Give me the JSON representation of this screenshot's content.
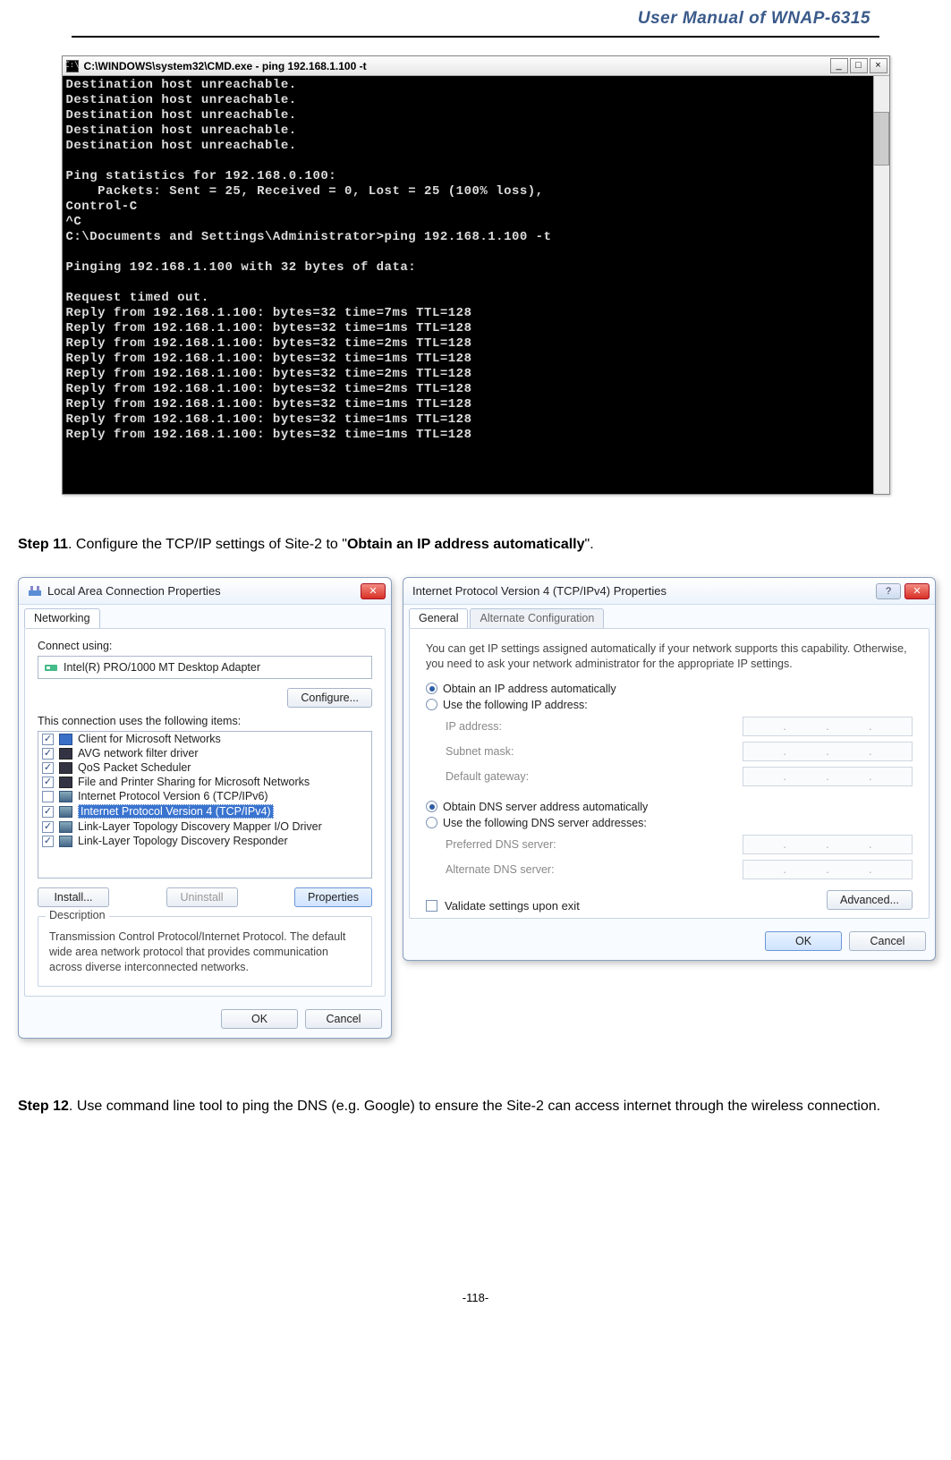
{
  "header": {
    "title": "User Manual of WNAP-6315"
  },
  "footer": {
    "page": "-118-"
  },
  "cmd": {
    "title": "C:\\WINDOWS\\system32\\CMD.exe - ping 192.168.1.100 -t",
    "lines": [
      "Destination host unreachable.",
      "Destination host unreachable.",
      "Destination host unreachable.",
      "Destination host unreachable.",
      "Destination host unreachable.",
      "",
      "Ping statistics for 192.168.0.100:",
      "    Packets: Sent = 25, Received = 0, Lost = 25 (100% loss),",
      "Control-C",
      "^C",
      "C:\\Documents and Settings\\Administrator>ping 192.168.1.100 -t",
      "",
      "Pinging 192.168.1.100 with 32 bytes of data:",
      "",
      "Request timed out.",
      "Reply from 192.168.1.100: bytes=32 time=7ms TTL=128",
      "Reply from 192.168.1.100: bytes=32 time=1ms TTL=128",
      "Reply from 192.168.1.100: bytes=32 time=2ms TTL=128",
      "Reply from 192.168.1.100: bytes=32 time=1ms TTL=128",
      "Reply from 192.168.1.100: bytes=32 time=2ms TTL=128",
      "Reply from 192.168.1.100: bytes=32 time=2ms TTL=128",
      "Reply from 192.168.1.100: bytes=32 time=1ms TTL=128",
      "Reply from 192.168.1.100: bytes=32 time=1ms TTL=128",
      "Reply from 192.168.1.100: bytes=32 time=1ms TTL=128"
    ],
    "btn_min": "_",
    "btn_max": "□",
    "btn_close": "×"
  },
  "step11": {
    "label": "Step 11",
    "text_before": ". Configure the TCP/IP settings of Site-2 to \"",
    "bold": "Obtain an IP address automatically",
    "text_after": "\"."
  },
  "step12": {
    "label": "Step 12",
    "text": ". Use command line tool to ping the DNS (e.g. Google) to ensure the Site-2 can access internet through the wireless connection."
  },
  "lac": {
    "title": "Local Area Connection Properties",
    "tab": "Networking",
    "connect_using_label": "Connect using:",
    "adapter": "Intel(R) PRO/1000 MT Desktop Adapter",
    "configure_btn": "Configure...",
    "items_label": "This connection uses the following items:",
    "items": [
      {
        "checked": true,
        "icon": "sq-blue",
        "label": "Client for Microsoft Networks"
      },
      {
        "checked": true,
        "icon": "sq-dark",
        "label": "AVG network filter driver"
      },
      {
        "checked": true,
        "icon": "sq-dark",
        "label": "QoS Packet Scheduler"
      },
      {
        "checked": true,
        "icon": "sq-dark",
        "label": "File and Printer Sharing for Microsoft Networks"
      },
      {
        "checked": false,
        "icon": "sq-net",
        "label": "Internet Protocol Version 6 (TCP/IPv6)"
      },
      {
        "checked": true,
        "icon": "sq-net",
        "label": "Internet Protocol Version 4 (TCP/IPv4)",
        "selected": true
      },
      {
        "checked": true,
        "icon": "sq-net",
        "label": "Link-Layer Topology Discovery Mapper I/O Driver"
      },
      {
        "checked": true,
        "icon": "sq-net",
        "label": "Link-Layer Topology Discovery Responder"
      }
    ],
    "install_btn": "Install...",
    "uninstall_btn": "Uninstall",
    "properties_btn": "Properties",
    "desc_title": "Description",
    "desc": "Transmission Control Protocol/Internet Protocol. The default wide area network protocol that provides communication across diverse interconnected networks.",
    "ok": "OK",
    "cancel": "Cancel",
    "close_glyph": "✕"
  },
  "ipv4": {
    "title": "Internet Protocol Version 4 (TCP/IPv4) Properties",
    "tab_general": "General",
    "tab_alt": "Alternate Configuration",
    "intro": "You can get IP settings assigned automatically if your network supports this capability. Otherwise, you need to ask your network administrator for the appropriate IP settings.",
    "radio_obtain_ip": "Obtain an IP address automatically",
    "radio_use_ip": "Use the following IP address:",
    "ip_label": "IP address:",
    "subnet_label": "Subnet mask:",
    "gateway_label": "Default gateway:",
    "radio_obtain_dns": "Obtain DNS server address automatically",
    "radio_use_dns": "Use the following DNS server addresses:",
    "pref_dns_label": "Preferred DNS server:",
    "alt_dns_label": "Alternate DNS server:",
    "validate": "Validate settings upon exit",
    "advanced": "Advanced...",
    "ok": "OK",
    "cancel": "Cancel",
    "help_glyph": "?",
    "close_glyph": "✕"
  }
}
